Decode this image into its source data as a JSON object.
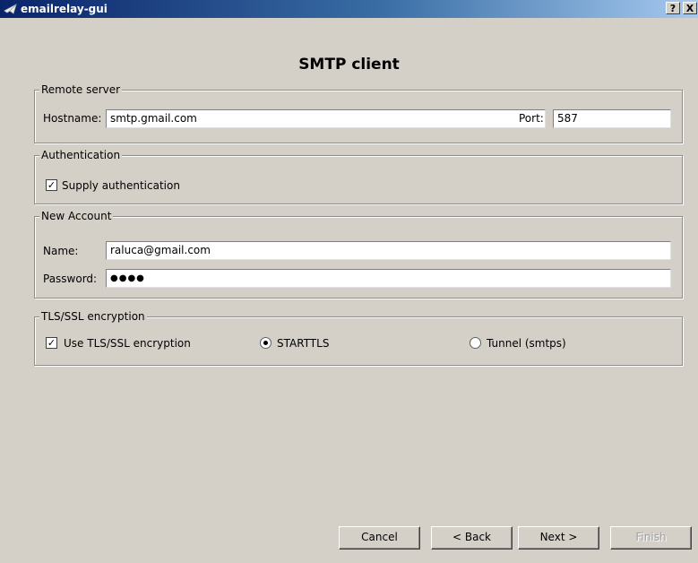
{
  "window": {
    "title": "emailrelay-gui",
    "help_label": "?",
    "close_label": "X"
  },
  "page": {
    "title": "SMTP client"
  },
  "remote_server": {
    "legend": "Remote server",
    "hostname_label": "Hostname:",
    "hostname_value": "smtp.gmail.com",
    "port_label": "Port:",
    "port_value": "587"
  },
  "authentication": {
    "legend": "Authentication",
    "supply_label": "Supply authentication",
    "supply_checked": true
  },
  "new_account": {
    "legend": "New Account",
    "name_label": "Name:",
    "name_value": "raluca@gmail.com",
    "password_label": "Password:",
    "password_value": "●●●●"
  },
  "tls": {
    "legend": "TLS/SSL encryption",
    "use_label": "Use TLS/SSL encryption",
    "use_checked": true,
    "starttls_label": "STARTTLS",
    "tunnel_label": "Tunnel (smtps)",
    "selected": "STARTTLS"
  },
  "buttons": {
    "cancel": "Cancel",
    "back": "< Back",
    "next": "Next >",
    "finish": "Finish"
  }
}
